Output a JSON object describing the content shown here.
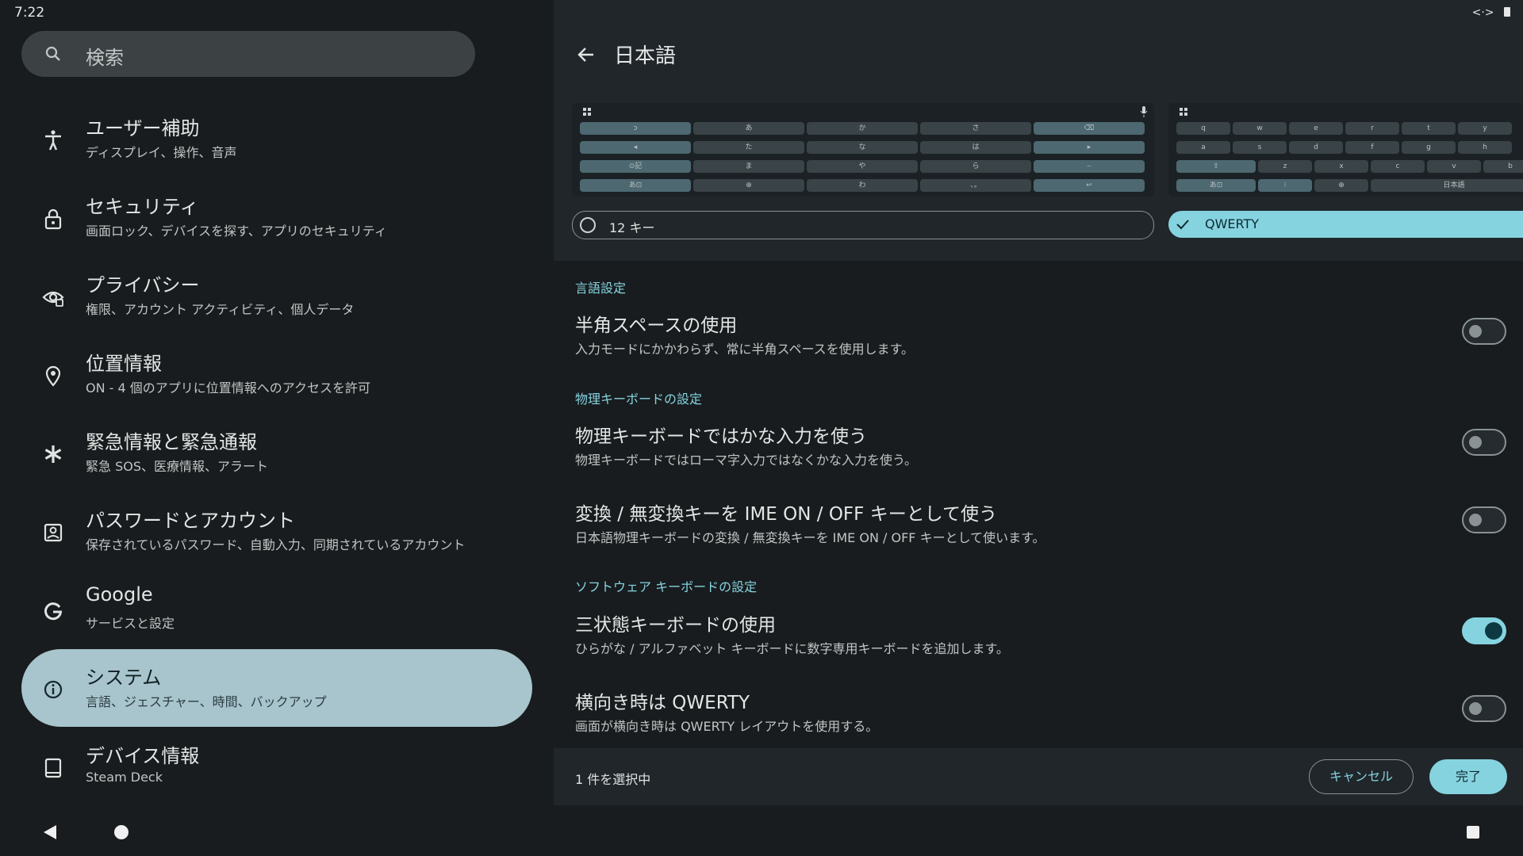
{
  "status_bar": {
    "time": "7:22"
  },
  "search": {
    "placeholder": "検索"
  },
  "sidebar": {
    "items": [
      {
        "title": "ユーザー補助",
        "subtitle": "ディスプレイ、操作、音声",
        "icon": "accessibility-icon"
      },
      {
        "title": "セキュリティ",
        "subtitle": "画面ロック、デバイスを探す、アプリのセキュリティ",
        "icon": "lock-icon"
      },
      {
        "title": "プライバシー",
        "subtitle": "権限、アカウント アクティビティ、個人データ",
        "icon": "privacy-eye-icon"
      },
      {
        "title": "位置情報",
        "subtitle": "ON - 4 個のアプリに位置情報へのアクセスを許可",
        "icon": "location-pin-icon"
      },
      {
        "title": "緊急情報と緊急通報",
        "subtitle": "緊急 SOS、医療情報、アラート",
        "icon": "emergency-asterisk-icon"
      },
      {
        "title": "パスワードとアカウント",
        "subtitle": "保存されているパスワード、自動入力、同期されているアカウント",
        "icon": "account-box-icon"
      },
      {
        "title": "Google",
        "subtitle": "サービスと設定",
        "icon": "google-icon"
      },
      {
        "title": "システム",
        "subtitle": "言語、ジェスチャー、時間、バックアップ",
        "icon": "info-icon",
        "selected": true
      },
      {
        "title": "デバイス情報",
        "subtitle": "Steam Deck",
        "icon": "tablet-icon"
      }
    ]
  },
  "detail": {
    "title": "日本語",
    "keyboard12": {
      "row1": [
        "ↄ",
        "あ",
        "か",
        "さ",
        "⌫"
      ],
      "row2": [
        "◂",
        "た",
        "な",
        "は",
        "▸"
      ],
      "row3": [
        "⊙記",
        "ま",
        "や",
        "ら",
        "⌣"
      ],
      "row4": [
        "あ⊡",
        "⊕",
        "わ",
        "、。",
        "↩"
      ]
    },
    "keyboard_qwerty": {
      "row1": [
        "q",
        "w",
        "e",
        "r",
        "t",
        "y"
      ],
      "row2": [
        "a",
        "s",
        "d",
        "f",
        "g",
        "h"
      ],
      "row3": [
        "⇧",
        "z",
        "x",
        "c",
        "v",
        "b"
      ],
      "row4": [
        "あ⊡",
        "⁝",
        "⊕",
        "日本語"
      ]
    },
    "layout_options": [
      {
        "label": "12 キー",
        "selected": false
      },
      {
        "label": "QWERTY",
        "selected": true
      }
    ],
    "sections": {
      "lang": "言語設定",
      "physical": "物理キーボードの設定",
      "software": "ソフトウェア キーボードの設定"
    },
    "rows": [
      {
        "title": "半角スペースの使用",
        "subtitle": "入力モードにかかわらず、常に半角スペースを使用します。",
        "on": false
      },
      {
        "title": "物理キーボードではかな入力を使う",
        "subtitle": "物理キーボードではローマ字入力ではなくかな入力を使う。",
        "on": false
      },
      {
        "title": "変換 / 無変換キーを IME ON / OFF キーとして使う",
        "subtitle": "日本語物理キーボードの変換 / 無変換キーを IME ON / OFF キーとして使います。",
        "on": false
      },
      {
        "title": "三状態キーボードの使用",
        "subtitle": "ひらがな / アルファベット キーボードに数字専用キーボードを追加します。",
        "on": true
      },
      {
        "title": "横向き時は QWERTY",
        "subtitle": "画面が横向き時は QWERTY レイアウトを使用する。",
        "on": false
      }
    ],
    "footer": {
      "selection": "1 件を選択中",
      "cancel": "キャンセル",
      "done": "完了"
    }
  },
  "colors": {
    "accent": "#86d3e0",
    "selected_nav": "#a8c4cc",
    "panel": "#20262a",
    "background": "#181c1e"
  }
}
